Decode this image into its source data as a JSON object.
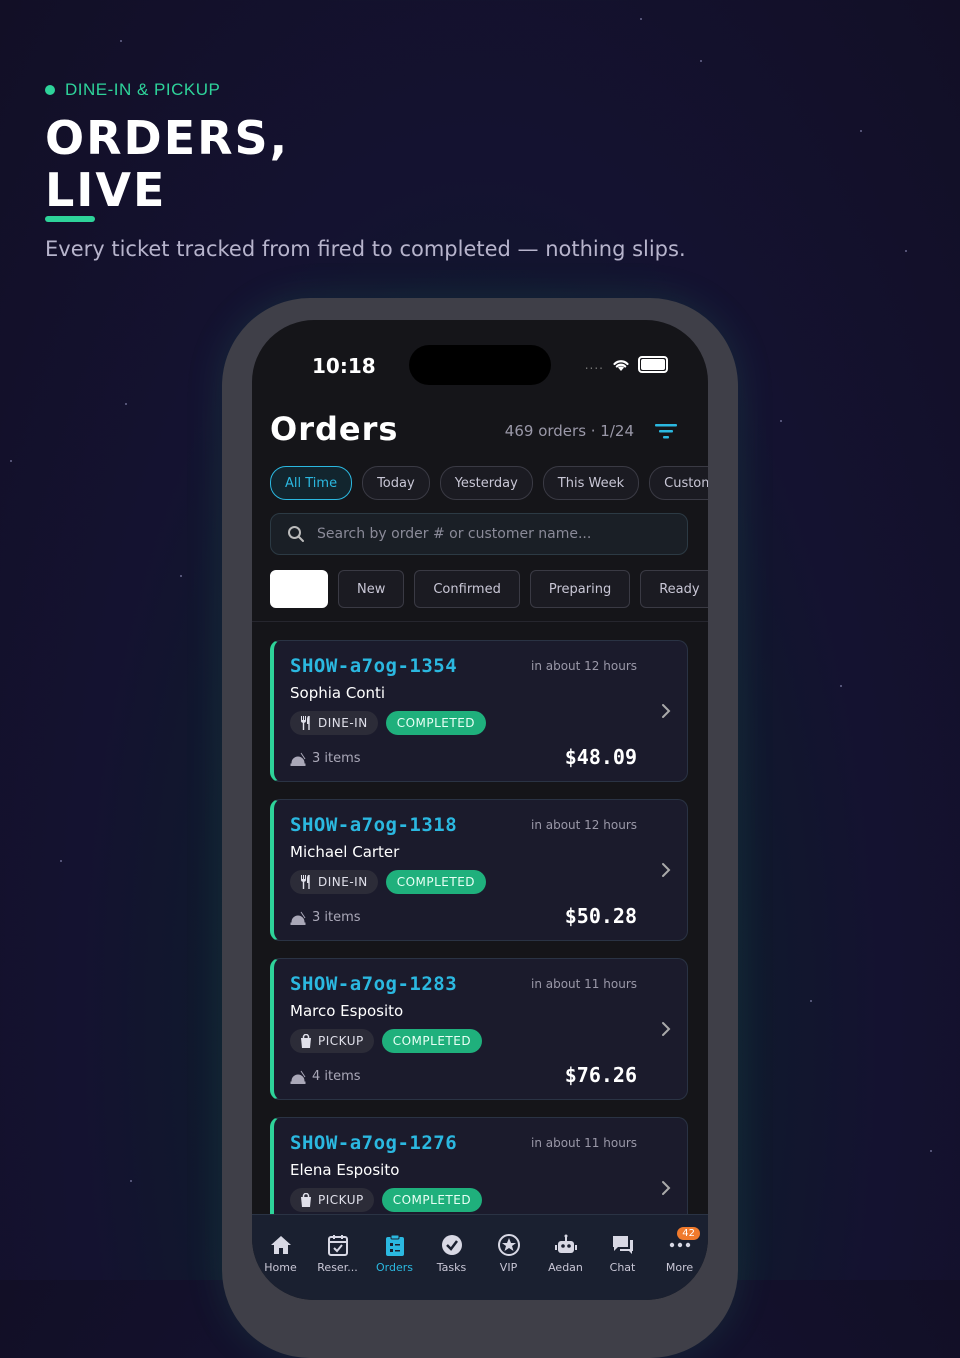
{
  "hero": {
    "eyebrow": "DINE-IN & PICKUP",
    "title_line1": "ORDERS,",
    "title_line2": "LIVE",
    "subtitle": "Every ticket tracked from fired to completed — nothing slips."
  },
  "status_bar": {
    "time": "10:18"
  },
  "header": {
    "title": "Orders",
    "count": "469 orders · 1/24"
  },
  "date_filters": [
    "All Time",
    "Today",
    "Yesterday",
    "This Week",
    "Custom R"
  ],
  "search": {
    "placeholder": "Search by order # or customer name..."
  },
  "status_filters": [
    "",
    "New",
    "Confirmed",
    "Preparing",
    "Ready"
  ],
  "orders": [
    {
      "id": "SHOW-a7og-1354",
      "time": "in about 12 hours",
      "customer": "Sophia Conti",
      "type": "DINE-IN",
      "status": "COMPLETED",
      "items": "3 items",
      "total": "$48.09"
    },
    {
      "id": "SHOW-a7og-1318",
      "time": "in about 12 hours",
      "customer": "Michael Carter",
      "type": "DINE-IN",
      "status": "COMPLETED",
      "items": "3 items",
      "total": "$50.28"
    },
    {
      "id": "SHOW-a7og-1283",
      "time": "in about 11 hours",
      "customer": "Marco Esposito",
      "type": "PICKUP",
      "status": "COMPLETED",
      "items": "4 items",
      "total": "$76.26"
    },
    {
      "id": "SHOW-a7og-1276",
      "time": "in about 11 hours",
      "customer": "Elena Esposito",
      "type": "PICKUP",
      "status": "COMPLETED",
      "items": "",
      "total": ""
    }
  ],
  "tabs": [
    {
      "label": "Home",
      "icon": "home-icon"
    },
    {
      "label": "Reser...",
      "icon": "calendar-icon"
    },
    {
      "label": "Orders",
      "icon": "clipboard-icon"
    },
    {
      "label": "Tasks",
      "icon": "check-circle-icon"
    },
    {
      "label": "VIP",
      "icon": "star-icon"
    },
    {
      "label": "Aedan",
      "icon": "robot-icon"
    },
    {
      "label": "Chat",
      "icon": "chat-icon"
    },
    {
      "label": "More",
      "icon": "more-icon",
      "badge": "42"
    }
  ],
  "colors": {
    "accent": "#2bb8e0",
    "success": "#2ed39a",
    "badge": "#f07a2c"
  }
}
